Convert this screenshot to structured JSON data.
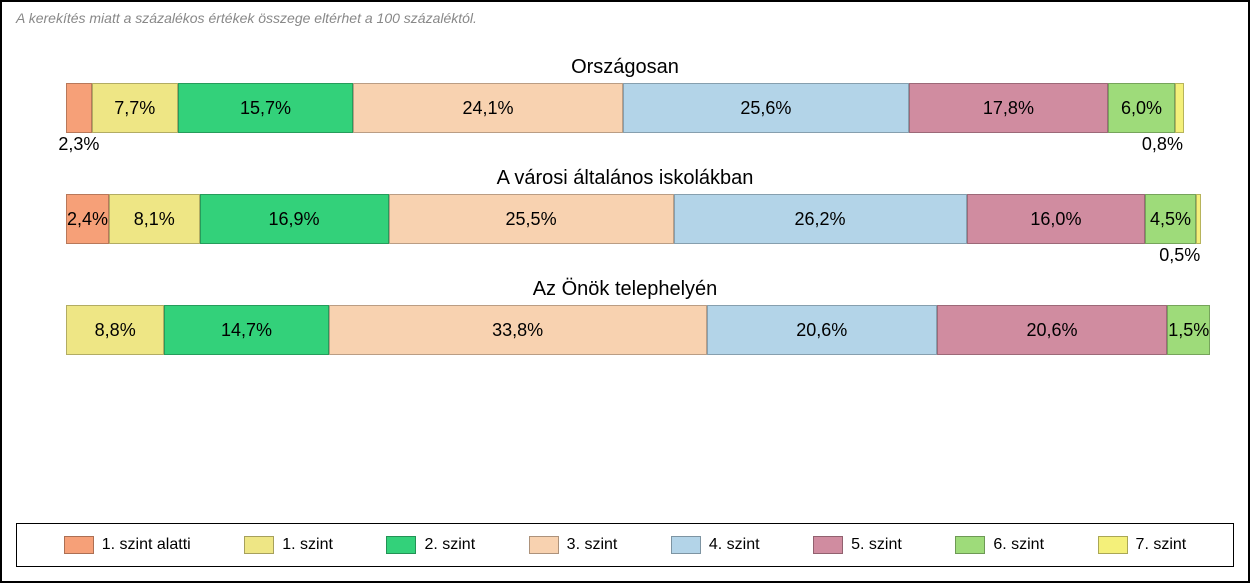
{
  "footnote": "A kerekítés miatt a  százalékos értékek összege eltérhet a 100 százaléktól.",
  "colors": {
    "l0": "#f6a078",
    "l1": "#eee685",
    "l2": "#33d17a",
    "l3": "#f8d2b0",
    "l4": "#b3d4e8",
    "l5": "#d08ca0",
    "l6": "#9edb7a",
    "l7": "#f4f07a"
  },
  "legend": [
    {
      "key": "l0",
      "label": "1. szint alatti"
    },
    {
      "key": "l1",
      "label": "1. szint"
    },
    {
      "key": "l2",
      "label": "2. szint"
    },
    {
      "key": "l3",
      "label": "3. szint"
    },
    {
      "key": "l4",
      "label": "4. szint"
    },
    {
      "key": "l5",
      "label": "5. szint"
    },
    {
      "key": "l6",
      "label": "6. szint"
    },
    {
      "key": "l7",
      "label": "7. szint"
    }
  ],
  "chart_data": {
    "type": "bar",
    "stacked": true,
    "orientation": "horizontal",
    "unit": "%",
    "categories": [
      "Országosan",
      "A városi általános iskolákban",
      "Az Önök telephelyén"
    ],
    "series_keys": [
      "l0",
      "l1",
      "l2",
      "l3",
      "l4",
      "l5",
      "l6",
      "l7"
    ],
    "rows": [
      {
        "title": "Országosan",
        "segments": [
          {
            "key": "l0",
            "value": 2.3,
            "label": "2,3%",
            "placement": "below"
          },
          {
            "key": "l1",
            "value": 7.7,
            "label": "7,7%",
            "placement": "in"
          },
          {
            "key": "l2",
            "value": 15.7,
            "label": "15,7%",
            "placement": "in"
          },
          {
            "key": "l3",
            "value": 24.1,
            "label": "24,1%",
            "placement": "in"
          },
          {
            "key": "l4",
            "value": 25.6,
            "label": "25,6%",
            "placement": "in"
          },
          {
            "key": "l5",
            "value": 17.8,
            "label": "17,8%",
            "placement": "in"
          },
          {
            "key": "l6",
            "value": 6.0,
            "label": "6,0%",
            "placement": "in"
          },
          {
            "key": "l7",
            "value": 0.8,
            "label": "0,8%",
            "placement": "below-right"
          }
        ]
      },
      {
        "title": "A városi általános iskolákban",
        "segments": [
          {
            "key": "l0",
            "value": 2.4,
            "label": "2,4%",
            "placement": "in"
          },
          {
            "key": "l1",
            "value": 8.1,
            "label": "8,1%",
            "placement": "in"
          },
          {
            "key": "l2",
            "value": 16.9,
            "label": "16,9%",
            "placement": "in"
          },
          {
            "key": "l3",
            "value": 25.5,
            "label": "25,5%",
            "placement": "in"
          },
          {
            "key": "l4",
            "value": 26.2,
            "label": "26,2%",
            "placement": "in"
          },
          {
            "key": "l5",
            "value": 16.0,
            "label": "16,0%",
            "placement": "in"
          },
          {
            "key": "l6",
            "value": 4.5,
            "label": "4,5%",
            "placement": "in"
          },
          {
            "key": "l7",
            "value": 0.5,
            "label": "0,5%",
            "placement": "below-right"
          }
        ]
      },
      {
        "title": "Az Önök telephelyén",
        "segments": [
          {
            "key": "l0",
            "value": 0.0,
            "label": "",
            "placement": "none"
          },
          {
            "key": "l1",
            "value": 8.8,
            "label": "8,8%",
            "placement": "in"
          },
          {
            "key": "l2",
            "value": 14.7,
            "label": "14,7%",
            "placement": "in"
          },
          {
            "key": "l3",
            "value": 33.8,
            "label": "33,8%",
            "placement": "in"
          },
          {
            "key": "l4",
            "value": 20.6,
            "label": "20,6%",
            "placement": "in"
          },
          {
            "key": "l5",
            "value": 20.6,
            "label": "20,6%",
            "placement": "in"
          },
          {
            "key": "l6",
            "value": 1.5,
            "label": "1,5%",
            "placement": "in"
          },
          {
            "key": "l7",
            "value": 0.0,
            "label": "",
            "placement": "none"
          }
        ]
      }
    ]
  }
}
